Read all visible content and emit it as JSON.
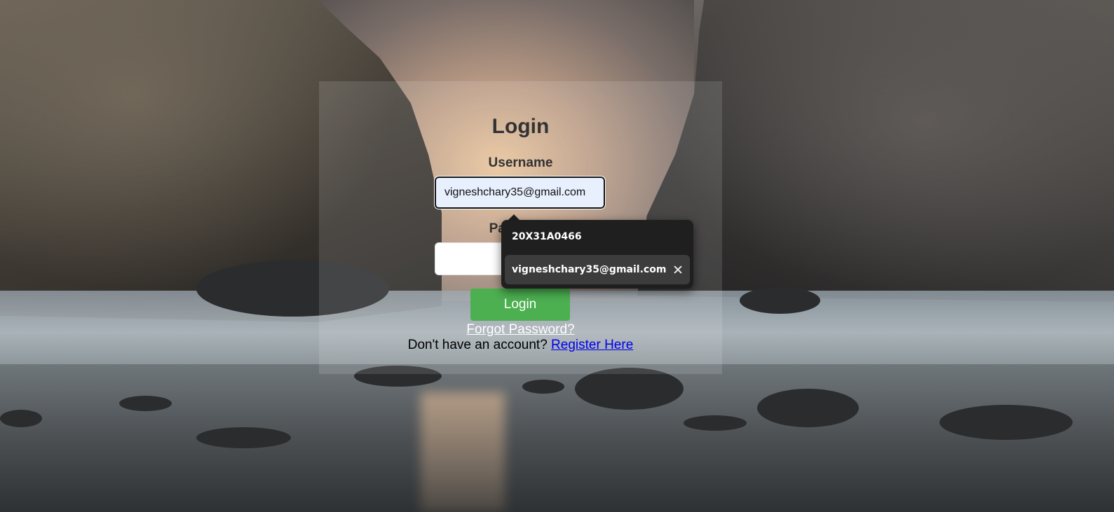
{
  "login_form": {
    "title": "Login",
    "username_label": "Username",
    "username_value": "vigneshchary35@gmail.com",
    "password_label": "Password",
    "password_value": "",
    "login_button": "Login",
    "forgot_password": "Forgot Password?",
    "register_prompt": "Don't have an account?",
    "register_link": "Register Here"
  },
  "autofill_dropdown": {
    "suggestions": [
      {
        "label": "20X31A0466"
      },
      {
        "label": "vigneshchary35@gmail.com",
        "removable": true
      }
    ],
    "remove_icon": "close-icon"
  },
  "colors": {
    "login_button": "#4caf50",
    "link": "#0000ee",
    "autofill_bg": "#1f1f1f",
    "autofill_highlight": "#3c3c3c",
    "username_autofill_bg": "#e8f0fe"
  }
}
